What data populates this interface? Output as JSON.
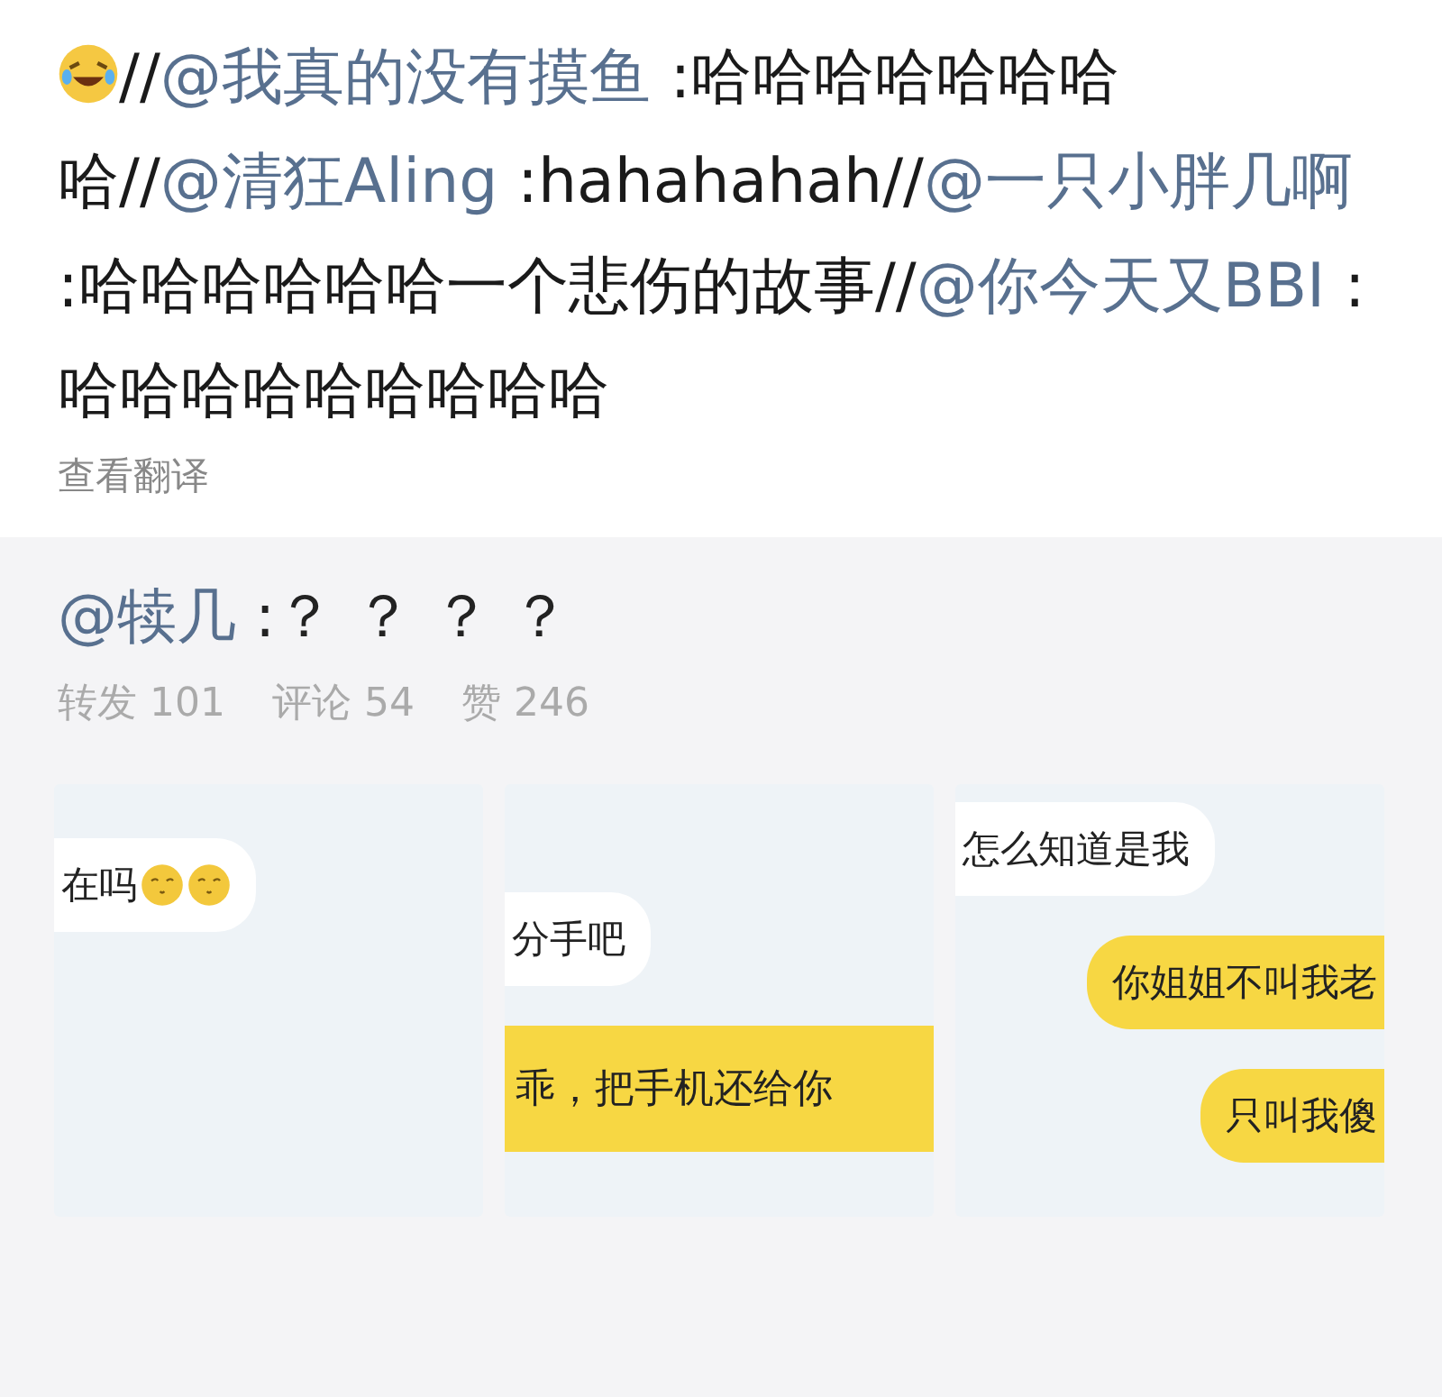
{
  "comment": {
    "segments": [
      {
        "kind": "text",
        "text": "//"
      },
      {
        "kind": "mention",
        "text": "@我真的没有摸鱼"
      },
      {
        "kind": "text",
        "text": " :哈哈哈哈哈哈哈哈//"
      },
      {
        "kind": "mention",
        "text": "@清狂Aling"
      },
      {
        "kind": "text",
        "text": " :hahahahah//"
      },
      {
        "kind": "mention",
        "text": "@一只小胖几啊"
      },
      {
        "kind": "text",
        "text": " :哈哈哈哈哈哈一个悲伤的故事//"
      },
      {
        "kind": "mention",
        "text": "@你今天又BBI"
      },
      {
        "kind": "text",
        "text": " :哈哈哈哈哈哈哈哈哈"
      }
    ],
    "translate": "查看翻译"
  },
  "original_post": {
    "author": "@犊几",
    "text": " :？ ？ ？ ？",
    "stats": [
      {
        "label": "转发",
        "count": "101"
      },
      {
        "label": "评论",
        "count": "54"
      },
      {
        "label": "赞",
        "count": "246"
      }
    ],
    "images": [
      {
        "messages": [
          {
            "kind": "received",
            "text": "在吗",
            "emoji": true
          }
        ]
      },
      {
        "messages": [
          {
            "kind": "received",
            "text": "分手吧",
            "emoji": false
          },
          {
            "kind": "banner",
            "text": "乖，把手机还给你",
            "emoji": false
          }
        ]
      },
      {
        "messages": [
          {
            "kind": "received",
            "text": "怎么知道是我",
            "emoji": false
          },
          {
            "kind": "sent",
            "text": "你姐姐不叫我老",
            "emoji": false
          },
          {
            "kind": "sent",
            "text": "只叫我傻",
            "emoji": false
          }
        ]
      }
    ]
  }
}
